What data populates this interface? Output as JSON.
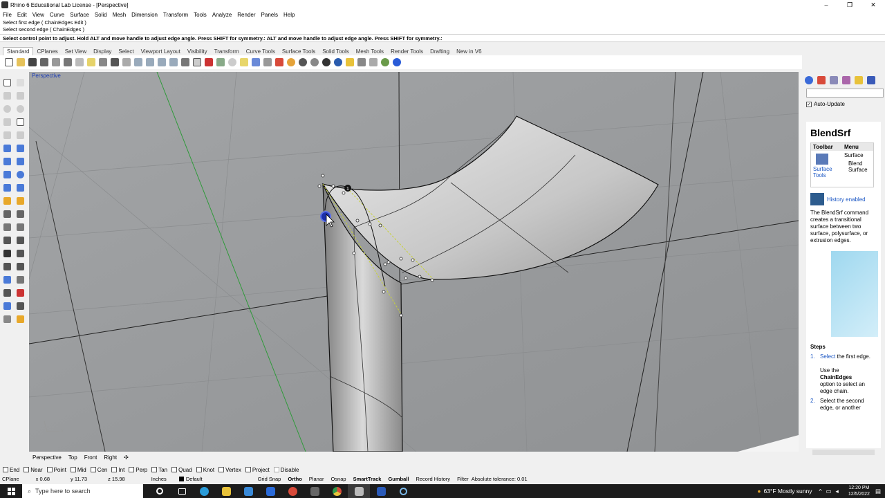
{
  "window": {
    "title": "Rhino 6 Educational Lab License - [Perspective]",
    "controls": [
      "–",
      "❐",
      "✕"
    ]
  },
  "menu": [
    "File",
    "Edit",
    "View",
    "Curve",
    "Surface",
    "Solid",
    "Mesh",
    "Dimension",
    "Transform",
    "Tools",
    "Analyze",
    "Render",
    "Panels",
    "Help"
  ],
  "command_history": [
    "Select first edge ( ChainEdges  Edit )",
    "Select second edge ( ChainEdges )"
  ],
  "command_prompt": "Select control point to adjust. Hold ALT and move handle to adjust edge angle. Press SHIFT for symmetry.:  ALT and move handle to adjust edge angle. Press SHIFT for symmetry.:",
  "toolbar_tabs": [
    "Standard",
    "CPlanes",
    "Set View",
    "Display",
    "Select",
    "Viewport Layout",
    "Visibility",
    "Transform",
    "Curve Tools",
    "Surface Tools",
    "Solid Tools",
    "Mesh Tools",
    "Render Tools",
    "Drafting",
    "New in V6"
  ],
  "viewport": {
    "label": "Perspective",
    "axes_label": "x"
  },
  "viewport_tabs": [
    "Perspective",
    "Top",
    "Front",
    "Right"
  ],
  "osnaps": [
    "End",
    "Near",
    "Point",
    "Mid",
    "Cen",
    "Int",
    "Perp",
    "Tan",
    "Quad",
    "Knot",
    "Vertex",
    "Project",
    "Disable"
  ],
  "status": {
    "cplane": "CPlane",
    "x": "x 0.68",
    "y": "y 11.73",
    "z": "z 15.98",
    "units": "Inches",
    "layer": "Default",
    "toggles": [
      "Grid Snap",
      "Ortho",
      "Planar",
      "Osnap",
      "SmartTrack",
      "Gumball",
      "Record History",
      "Filter"
    ],
    "tolerance": "Absolute tolerance: 0.01"
  },
  "panel": {
    "auto_update": "Auto-Update",
    "help_title": "BlendSrf",
    "table": {
      "col1": "Toolbar",
      "col2": "Menu",
      "toolbar_text": "Surface Tools",
      "menu_text1": "Surface",
      "menu_text2": "Blend Surface"
    },
    "history": "History enabled",
    "description": "The BlendSrf command creates a transitional surface between two surface, polysurface, or extrusion edges.",
    "steps_title": "Steps",
    "step1_link": "Select",
    "step1_rest": " the first edge.",
    "step1_extra1": "Use the",
    "step1_extra2": "ChainEdges",
    "step1_extra3": "option to select an edge chain.",
    "step2": "Select the second edge, or another"
  },
  "taskbar": {
    "search_placeholder": "Type here to search",
    "weather": "63°F  Mostly sunny",
    "time": "12:20 PM",
    "date": "12/5/2022"
  },
  "colors": {
    "viewport_bg": "#9b9d9f",
    "accent": "#1a56c4"
  }
}
